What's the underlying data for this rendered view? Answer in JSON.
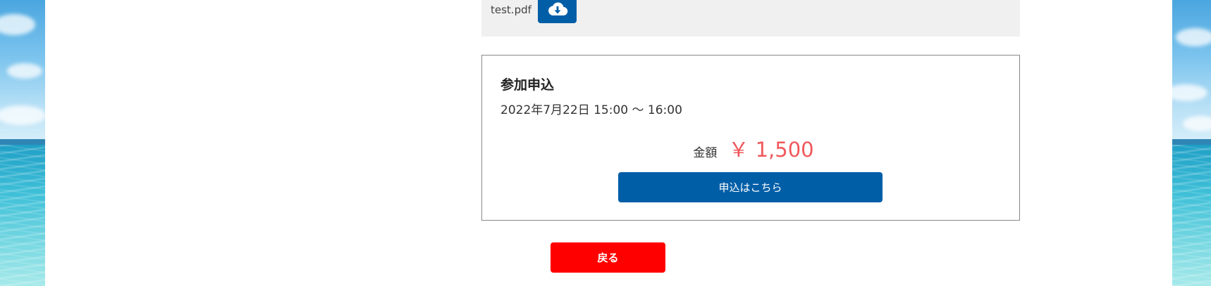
{
  "attachment": {
    "file_name": "test.pdf",
    "download_icon": "cloud-download-icon"
  },
  "application": {
    "title": "参加申込",
    "date_time": "2022年7月22日 15:00 〜 16:00",
    "price_label": "金額",
    "price_value": "￥ 1,500",
    "apply_button_label": "申込はこちら"
  },
  "footer": {
    "back_button_label": "戻る"
  },
  "colors": {
    "primary_blue": "#005ea7",
    "price_red": "#f0585c",
    "back_red": "#ff0000",
    "file_box_bg": "#f0f0f0"
  }
}
